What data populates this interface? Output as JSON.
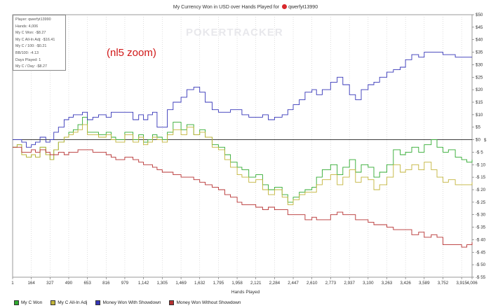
{
  "chart_data": {
    "type": "line",
    "title": "My Currency Won in USD over Hands Played for",
    "player_name": "qwerfyt13990",
    "xlabel": "Hands Played",
    "ylabel": "$",
    "watermark": "POKERTRACKER",
    "annotation": "(nl5 zoom)",
    "stats_box": [
      "Player: qwerfyt13990",
      "Hands: 4,006",
      "My C Won: -$8.27",
      "My C All-In Adj: -$16.41",
      "My C / 100: -$0.21",
      "BB/100: -4.13",
      "Days Played: 1",
      "My C / Day: -$8.27"
    ],
    "x_ticks": [
      "1",
      "164",
      "327",
      "490",
      "653",
      "816",
      "979",
      "1,142",
      "1,305",
      "1,469",
      "1,632",
      "1,795",
      "1,958",
      "2,121",
      "2,284",
      "2,447",
      "2,610",
      "2,773",
      "2,937",
      "3,100",
      "3,263",
      "3,426",
      "3,589",
      "3,752",
      "3,915",
      "4,006"
    ],
    "x_range": [
      1,
      4006
    ],
    "y_ticks": [
      "$50",
      "$45",
      "$40",
      "$35",
      "$30",
      "$25",
      "$20",
      "$15",
      "$10",
      "$5",
      "$0",
      "-$ 5",
      "-$ 10",
      "-$ 15",
      "-$ 20",
      "-$ 25",
      "-$ 30",
      "-$ 35",
      "-$ 40",
      "-$ 45",
      "-$ 50",
      "-$ 55"
    ],
    "ylim": [
      -55,
      50
    ],
    "grid": "vertical dotted",
    "legend_position": "bottom",
    "series": [
      {
        "name": "My C Won",
        "color": "#2faa2f",
        "x": [
          1,
          40,
          80,
          120,
          164,
          200,
          240,
          290,
          327,
          360,
          400,
          450,
          490,
          530,
          570,
          610,
          653,
          700,
          750,
          816,
          860,
          900,
          979,
          1050,
          1100,
          1142,
          1180,
          1220,
          1260,
          1305,
          1350,
          1400,
          1469,
          1520,
          1580,
          1632,
          1680,
          1740,
          1795,
          1850,
          1900,
          1958,
          2000,
          2060,
          2121,
          2180,
          2230,
          2284,
          2350,
          2400,
          2447,
          2500,
          2550,
          2610,
          2650,
          2700,
          2773,
          2830,
          2880,
          2937,
          2990,
          3040,
          3100,
          3150,
          3200,
          3263,
          3320,
          3380,
          3426,
          3480,
          3540,
          3589,
          3650,
          3700,
          3752,
          3800,
          3860,
          3915,
          3960,
          4006
        ],
        "y": [
          -3,
          -2,
          -6,
          -7,
          -6,
          -7,
          -3,
          -6,
          -8,
          -4,
          -1,
          1,
          3,
          4,
          6,
          9,
          3,
          3,
          2,
          3,
          1,
          0,
          3,
          0,
          2,
          -1,
          0,
          2,
          1,
          0,
          3,
          7,
          4,
          6,
          2,
          4,
          1,
          -2,
          -3,
          -6,
          -9,
          -11,
          -12,
          -15,
          -14,
          -18,
          -20,
          -19,
          -22,
          -25,
          -23,
          -21,
          -20,
          -19,
          -15,
          -12,
          -10,
          -14,
          -11,
          -8,
          -13,
          -10,
          -11,
          -15,
          -13,
          -10,
          -4,
          -6,
          -5,
          -3,
          -5,
          -2,
          0,
          -3,
          -5,
          -4,
          -7,
          -8,
          -9,
          -8
        ]
      },
      {
        "name": "My C All-In Adj",
        "color": "#c2b43a",
        "x": [
          1,
          40,
          80,
          120,
          164,
          200,
          240,
          290,
          327,
          360,
          400,
          450,
          490,
          530,
          570,
          610,
          653,
          700,
          750,
          816,
          860,
          900,
          979,
          1050,
          1100,
          1142,
          1180,
          1220,
          1260,
          1305,
          1350,
          1400,
          1469,
          1520,
          1580,
          1632,
          1680,
          1740,
          1795,
          1850,
          1900,
          1958,
          2000,
          2060,
          2121,
          2180,
          2230,
          2284,
          2350,
          2400,
          2447,
          2500,
          2550,
          2610,
          2650,
          2700,
          2773,
          2830,
          2880,
          2937,
          2990,
          3040,
          3100,
          3150,
          3200,
          3263,
          3320,
          3380,
          3426,
          3480,
          3540,
          3589,
          3650,
          3700,
          3752,
          3800,
          3860,
          3915,
          3960,
          4006
        ],
        "y": [
          -3,
          -2,
          -6,
          -7,
          -6,
          -7,
          -3,
          -6,
          -8,
          -4,
          -1,
          1,
          2,
          3,
          4,
          6,
          2,
          2,
          1,
          2,
          0,
          -1,
          2,
          -1,
          1,
          -2,
          -1,
          1,
          0,
          -1,
          2,
          4,
          2,
          5,
          2,
          3,
          1,
          -3,
          -4,
          -8,
          -11,
          -14,
          -15,
          -17,
          -16,
          -20,
          -22,
          -20,
          -23,
          -26,
          -24,
          -22,
          -21,
          -21,
          -18,
          -16,
          -14,
          -18,
          -15,
          -12,
          -17,
          -15,
          -16,
          -20,
          -18,
          -15,
          -10,
          -13,
          -12,
          -10,
          -12,
          -9,
          -12,
          -15,
          -17,
          -16,
          -18,
          -18,
          -18,
          -17
        ]
      },
      {
        "name": "Money Won With Showdown",
        "color": "#3535b8",
        "x": [
          1,
          40,
          80,
          120,
          164,
          200,
          240,
          290,
          327,
          360,
          400,
          450,
          490,
          530,
          570,
          610,
          653,
          700,
          750,
          816,
          860,
          900,
          979,
          1050,
          1100,
          1142,
          1180,
          1220,
          1260,
          1305,
          1350,
          1400,
          1469,
          1520,
          1580,
          1632,
          1680,
          1740,
          1795,
          1850,
          1900,
          1958,
          2000,
          2060,
          2121,
          2180,
          2230,
          2284,
          2350,
          2400,
          2447,
          2500,
          2550,
          2610,
          2650,
          2700,
          2773,
          2830,
          2880,
          2937,
          2990,
          3040,
          3100,
          3150,
          3200,
          3263,
          3320,
          3380,
          3426,
          3480,
          3540,
          3589,
          3650,
          3700,
          3752,
          3800,
          3860,
          3915,
          3960,
          4006
        ],
        "y": [
          0,
          0,
          -1,
          -3,
          -2,
          -1,
          1,
          -1,
          0,
          3,
          5,
          8,
          9,
          10,
          10,
          11,
          8,
          9,
          10,
          9,
          11,
          11,
          11,
          8,
          10,
          8,
          10,
          11,
          5,
          5,
          12,
          15,
          17,
          20,
          21,
          19,
          15,
          12,
          11,
          11,
          12,
          12,
          10,
          9,
          9,
          10,
          8,
          9,
          10,
          12,
          14,
          16,
          19,
          20,
          18,
          20,
          23,
          25,
          22,
          18,
          16,
          20,
          22,
          23,
          25,
          27,
          28,
          29,
          32,
          34,
          33,
          35,
          35,
          35,
          34,
          34,
          33,
          33,
          33,
          33
        ]
      },
      {
        "name": "Money Won Without Showdown",
        "color": "#b63030",
        "x": [
          1,
          40,
          80,
          120,
          164,
          200,
          240,
          290,
          327,
          360,
          400,
          450,
          490,
          530,
          570,
          610,
          653,
          700,
          750,
          816,
          860,
          900,
          979,
          1050,
          1100,
          1142,
          1180,
          1220,
          1260,
          1305,
          1350,
          1400,
          1469,
          1520,
          1580,
          1632,
          1680,
          1740,
          1795,
          1850,
          1900,
          1958,
          2000,
          2060,
          2121,
          2180,
          2230,
          2284,
          2350,
          2400,
          2447,
          2500,
          2550,
          2610,
          2650,
          2700,
          2773,
          2830,
          2880,
          2937,
          2990,
          3040,
          3100,
          3150,
          3200,
          3263,
          3320,
          3380,
          3426,
          3480,
          3540,
          3589,
          3650,
          3700,
          3752,
          3800,
          3860,
          3915,
          3960,
          4006
        ],
        "y": [
          -3,
          -3,
          -5,
          -5,
          -4,
          -5,
          -4,
          -5,
          -6,
          -6,
          -5,
          -6,
          -5,
          -5,
          -4,
          -4,
          -4,
          -5,
          -5,
          -6,
          -7,
          -8,
          -7,
          -8,
          -9,
          -10,
          -10,
          -11,
          -12,
          -13,
          -13,
          -14,
          -15,
          -15,
          -16,
          -17,
          -18,
          -19,
          -20,
          -22,
          -23,
          -25,
          -26,
          -26,
          -27,
          -28,
          -27,
          -28,
          -28,
          -30,
          -30,
          -30,
          -32,
          -31,
          -32,
          -32,
          -30,
          -29,
          -30,
          -30,
          -32,
          -32,
          -33,
          -34,
          -34,
          -35,
          -36,
          -36,
          -36,
          -38,
          -37,
          -39,
          -38,
          -39,
          -42,
          -42,
          -42,
          -43,
          -42,
          -41
        ]
      }
    ]
  }
}
